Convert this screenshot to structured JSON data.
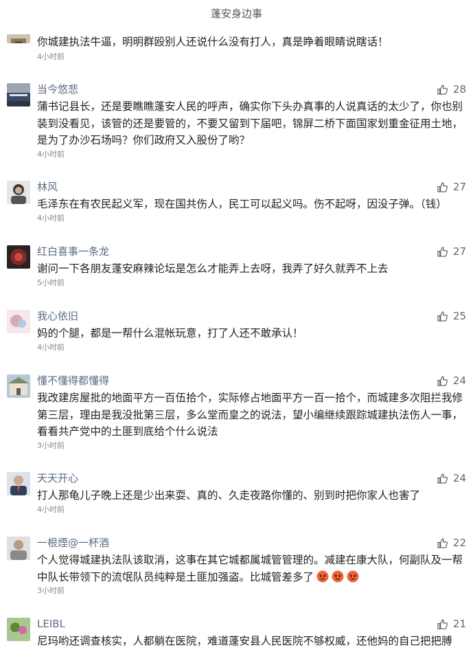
{
  "header": {
    "title": "蓬安身边事"
  },
  "comments": [
    {
      "username": "",
      "likes": "",
      "content": "你城建执法牛逼，明明群殴别人还说什么没有打人，真是睁着眼睛说瞎话！",
      "time": "4小时前",
      "avatar_color": "#8a7a5a"
    },
    {
      "username": "当今悠悲",
      "likes": "28",
      "content": "蒲书记县长，还是要瞧瞧蓬安人民的呼声，确实你下头办真事的人说真话的太少了，你也别装到没看见，该管的还是要管的，不要又留到下届吧，锦屏二桥下面国家划重金征用土地，是为了办沙石场吗？你们政府又入股份了哟？",
      "time": "4小时前",
      "avatar_color": "#3a4a66"
    },
    {
      "username": "林风",
      "likes": "27",
      "content": "毛泽东在有农民起义军，现在国共伤人，民工可以起义吗。伤不起呀，因没子弹。（钱）",
      "time": "4小时前",
      "avatar_color": "#666666"
    },
    {
      "username": "红白喜事一条龙",
      "likes": "27",
      "content": "谢问一下各朋友蓬安麻辣论坛是怎么才能弄上去呀，我弄了好久就弄不上去",
      "time": "5小时前",
      "avatar_color": "#7a2a2a"
    },
    {
      "username": "我心依旧",
      "likes": "25",
      "content": "妈的个腿，都是一帮什么混帐玩意，打了人还不敢承认！",
      "time": "4小时前",
      "avatar_color": "#d7aab4"
    },
    {
      "username": "懂不懂得都懂得",
      "likes": "24",
      "content": "我改建房屋批的地面平方一百伍拾个，实际修占地面平方一百一拾个，而城建多次阻拦我修第三层，理由是我没批第三层，多么堂而皇之的说法，望小编继续跟踪城建执法伤人一事，看看共产党中的土匪到底给个什么说法",
      "time": "3小时前",
      "avatar_color": "#7a8a6a"
    },
    {
      "username": "天天开心",
      "likes": "24",
      "content": "打人那龟儿子晚上还是少出来耍、真的、久走夜路你懂的、别到时把你家人也害了",
      "time": "4小时前",
      "avatar_color": "#34405a"
    },
    {
      "username": "一根煙@一杯酒",
      "likes": "22",
      "content": "个人觉得城建执法队该取消，这事在其它城都属城管管理的。减建在康大队，何副队及一帮中队长带领下的流氓队员纯粹是土匪加强盗。比城管差多了",
      "time": "3小时前",
      "avatar_color": "#8a8a8a"
    },
    {
      "username": "LEIBL",
      "likes": "21",
      "content": "尼玛哟还调查核实，人都躺在医院，难道蓬安县人民医院不够权威，还他妈的自己把把膊",
      "time": "",
      "avatar_color": "#5a8a3a"
    }
  ]
}
